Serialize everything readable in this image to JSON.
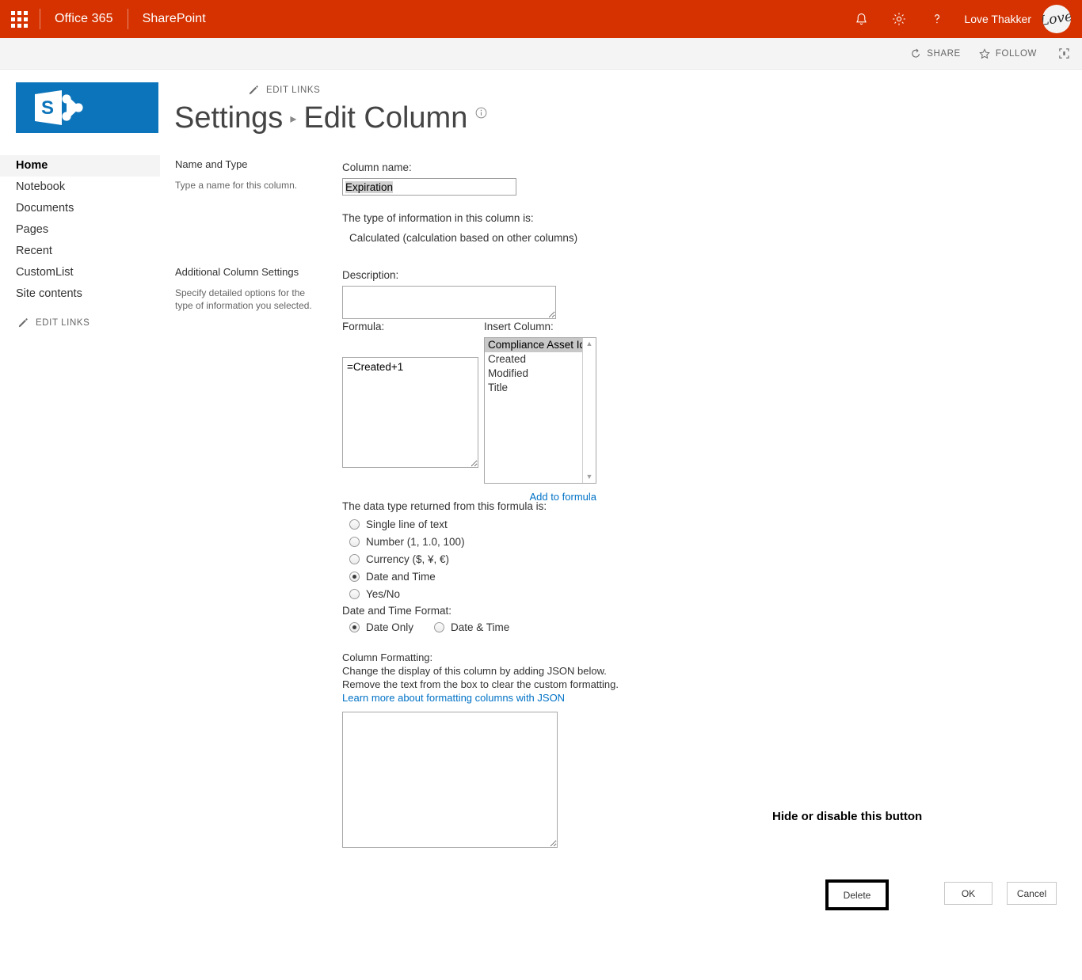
{
  "suite_bar": {
    "waffle_icon": "app-launcher-icon",
    "brand": "Office 365",
    "app": "SharePoint",
    "notifications_icon": "bell-icon",
    "settings_icon": "gear-icon",
    "help_icon": "help-icon",
    "user_name": "Love Thakker",
    "avatar_text": "Love",
    "accent_color": "#d53200"
  },
  "command_bar": {
    "share_label": "SHARE",
    "follow_label": "FOLLOW",
    "focus_icon": "focus-on-content-icon"
  },
  "sidebar": {
    "logo_alt": "sharepoint-logo",
    "items": [
      {
        "label": "Home",
        "selected": true
      },
      {
        "label": "Notebook",
        "selected": false
      },
      {
        "label": "Documents",
        "selected": false
      },
      {
        "label": "Pages",
        "selected": false
      },
      {
        "label": "Recent",
        "selected": false
      },
      {
        "label": "CustomList",
        "selected": false
      },
      {
        "label": "Site contents",
        "selected": false
      }
    ],
    "edit_links_label": "EDIT LINKS"
  },
  "main": {
    "edit_links_label": "EDIT LINKS",
    "breadcrumb_parent": "Settings",
    "breadcrumb_separator": "▸",
    "title": "Edit Column",
    "info_icon": "info-icon"
  },
  "sections": {
    "name_and_type": {
      "title": "Name and Type",
      "description": "Type a name for this column."
    },
    "additional_settings": {
      "title": "Additional Column Settings",
      "description": "Specify detailed options for the type of information you selected."
    }
  },
  "form": {
    "column_name_label": "Column name:",
    "column_name_value": "Expiration",
    "type_label": "The type of information in this column is:",
    "type_value": "Calculated (calculation based on other columns)",
    "description_label": "Description:",
    "description_value": "",
    "formula_label": "Formula:",
    "formula_value": "=Created+1",
    "insert_column_label": "Insert Column:",
    "insert_column_options": [
      {
        "label": "Compliance Asset Id",
        "selected": true
      },
      {
        "label": "Created",
        "selected": false
      },
      {
        "label": "Modified",
        "selected": false
      },
      {
        "label": "Title",
        "selected": false
      }
    ],
    "add_to_formula_label": "Add to formula",
    "data_type_label": "The data type returned from this formula is:",
    "data_type_options": [
      {
        "label": "Single line of text",
        "selected": false
      },
      {
        "label": "Number (1, 1.0, 100)",
        "selected": false
      },
      {
        "label": "Currency ($, ¥, €)",
        "selected": false
      },
      {
        "label": "Date and Time",
        "selected": true
      },
      {
        "label": "Yes/No",
        "selected": false
      }
    ],
    "date_format_label": "Date and Time Format:",
    "date_format_options": [
      {
        "label": "Date Only",
        "selected": true
      },
      {
        "label": "Date & Time",
        "selected": false
      }
    ],
    "column_formatting_label": "Column Formatting:",
    "column_formatting_line1": "Change the display of this column by adding JSON below.",
    "column_formatting_line2": "Remove the text from the box to clear the custom formatting.",
    "column_formatting_link": "Learn more about formatting columns with JSON",
    "column_formatting_value": ""
  },
  "annotation": {
    "text": "Hide or disable this button",
    "color": "#000000"
  },
  "buttons": {
    "delete_label": "Delete",
    "ok_label": "OK",
    "cancel_label": "Cancel",
    "highlight_color": "#000000"
  }
}
